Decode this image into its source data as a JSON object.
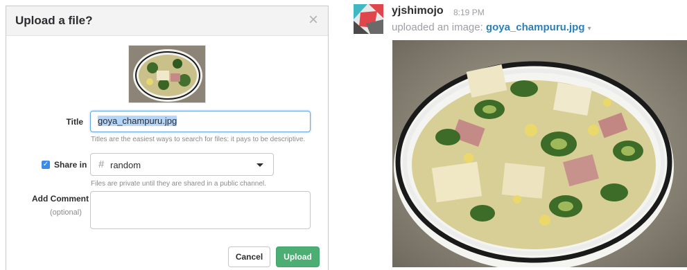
{
  "dialog": {
    "title": "Upload a file?",
    "close_label": "×",
    "title_label": "Title",
    "title_value": "goya_champuru.jpg",
    "title_hint": "Titles are the easiest ways to search for files: it pays to be descriptive.",
    "share_label": "Share in",
    "share_checked": true,
    "channel_hash": "#",
    "channel_name": "random",
    "share_hint": "Files are private until they are shared in a public channel.",
    "comment_label": "Add Comment",
    "comment_optional": "(optional)",
    "cancel_label": "Cancel",
    "upload_label": "Upload"
  },
  "message": {
    "username": "yjshimojo",
    "timestamp": "8:19 PM",
    "action_text": "uploaded an image:",
    "file_name": "goya_champuru.jpg",
    "caret": "▾"
  },
  "colors": {
    "accent_blue": "#3b8be8",
    "upload_green": "#4cae72",
    "link_blue": "#2a80b9"
  }
}
